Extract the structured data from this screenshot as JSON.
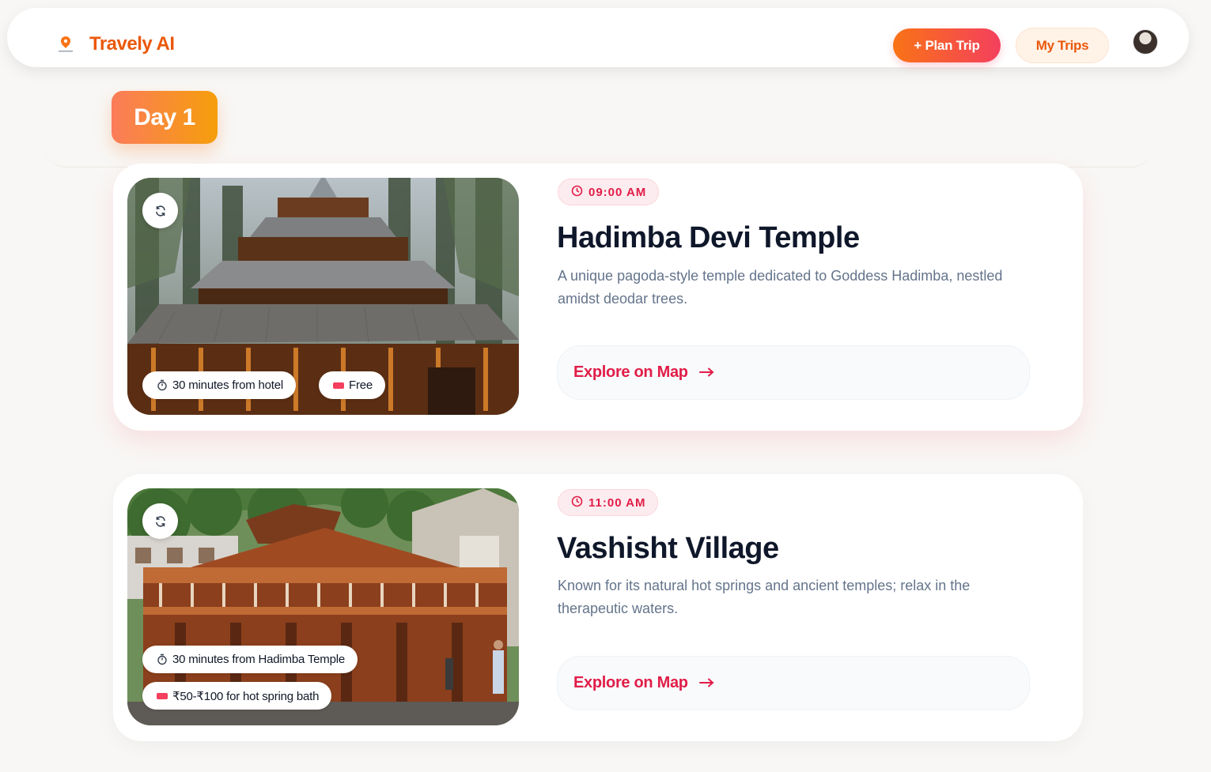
{
  "header": {
    "brand": "Travely AI",
    "plan_trip_label": "+ Plan Trip",
    "my_trips_label": "My Trips"
  },
  "colors": {
    "accent_orange": "#ea580c",
    "accent_rose": "#e11d48",
    "gradient_start": "#f97316",
    "gradient_end": "#f43f5e"
  },
  "day": {
    "label": "Day 1"
  },
  "activities": [
    {
      "time": "09:00 AM",
      "title": "Hadimba Devi Temple",
      "description": "A unique pagoda-style temple dedicated to Goddess Hadimba, nestled amidst deodar trees.",
      "distance": "30 minutes from hotel",
      "cost": "Free",
      "map_label": "Explore on Map",
      "image_icon": "refresh-icon"
    },
    {
      "time": "11:00 AM",
      "title": "Vashisht Village",
      "description": "Known for its natural hot springs and ancient temples; relax in the therapeutic waters.",
      "distance": "30 minutes from Hadimba Temple",
      "cost": "₹50-₹100 for hot spring bath",
      "map_label": "Explore on Map",
      "image_icon": "refresh-icon"
    }
  ]
}
